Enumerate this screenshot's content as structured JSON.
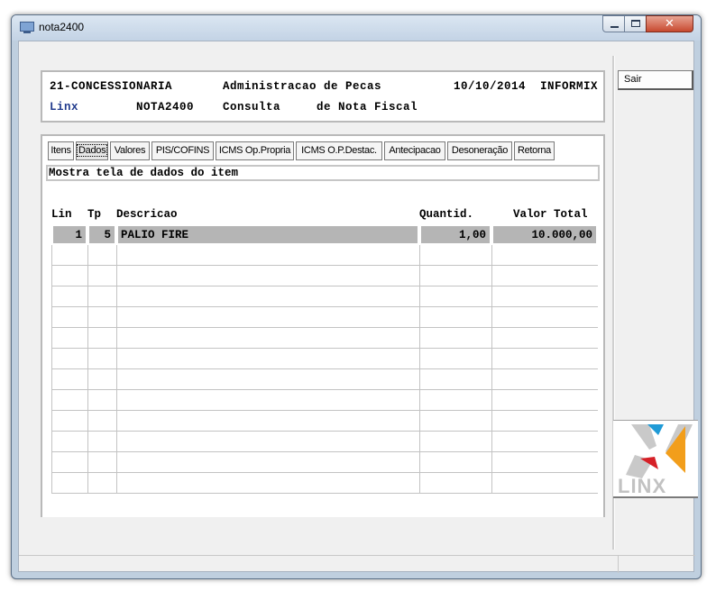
{
  "window": {
    "title": "nota2400"
  },
  "header": {
    "company": "21-CONCESSIONARIA",
    "module": "Administracao de Pecas",
    "date": "10/10/2014",
    "db": "INFORMIX",
    "brand": "Linx",
    "program": "NOTA2400",
    "action": "Consulta",
    "subject": "de Nota Fiscal"
  },
  "tabs": [
    {
      "label": "Itens"
    },
    {
      "label": "Dados"
    },
    {
      "label": "Valores"
    },
    {
      "label": "PIS/COFINS"
    },
    {
      "label": "ICMS Op.Propria"
    },
    {
      "label": "ICMS O.P.Destac."
    },
    {
      "label": "Antecipacao"
    },
    {
      "label": "Desoneração"
    },
    {
      "label": "Retorna"
    }
  ],
  "active_tab": "Dados",
  "hint": "Mostra tela de dados do item",
  "table": {
    "columns": [
      "Lin",
      "Tp",
      "Descricao",
      "Quantid.",
      "Valor Total"
    ],
    "rows": [
      {
        "lin": "1",
        "tp": "5",
        "descricao": "PALIO FIRE",
        "quantid": "1,00",
        "valor_total": "10.000,00"
      }
    ]
  },
  "side": {
    "exit_label": "Sair",
    "logo_text": "LINX"
  },
  "colors": {
    "brand_blue": "#203a8c",
    "logo_blue": "#1f9ad6",
    "logo_orange": "#f29e1b",
    "logo_red": "#d62027",
    "selected_row": "#b5b5b5"
  }
}
